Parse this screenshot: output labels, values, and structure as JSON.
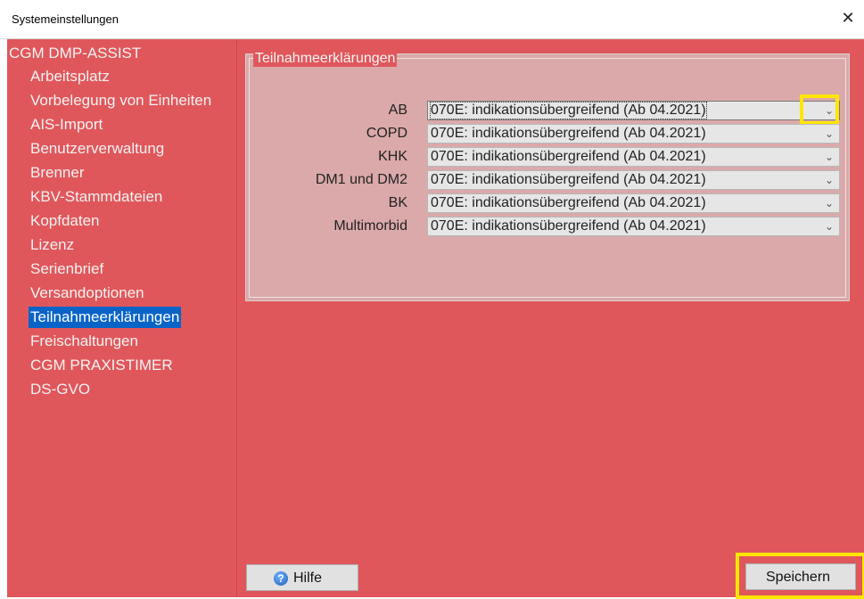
{
  "window": {
    "title": "Systemeinstellungen",
    "close_glyph": "✕"
  },
  "sidebar": {
    "root": "CGM DMP-ASSIST",
    "items": [
      {
        "label": "Arbeitsplatz"
      },
      {
        "label": "Vorbelegung von Einheiten"
      },
      {
        "label": "AIS-Import"
      },
      {
        "label": "Benutzerverwaltung"
      },
      {
        "label": "Brenner"
      },
      {
        "label": "KBV-Stammdateien"
      },
      {
        "label": "Kopfdaten"
      },
      {
        "label": "Lizenz"
      },
      {
        "label": "Serienbrief"
      },
      {
        "label": "Versandoptionen"
      },
      {
        "label": "Teilnahmeerklärungen",
        "selected": true
      },
      {
        "label": "Freischaltungen"
      },
      {
        "label": "CGM PRAXISTIMER"
      },
      {
        "label": "DS-GVO"
      }
    ]
  },
  "panel": {
    "title": "Teilnahmeerklärungen",
    "rows": [
      {
        "label": "AB",
        "value": "070E: indikationsübergreifend (Ab 04.2021)"
      },
      {
        "label": "COPD",
        "value": "070E: indikationsübergreifend (Ab 04.2021)"
      },
      {
        "label": "KHK",
        "value": "070E: indikationsübergreifend (Ab 04.2021)"
      },
      {
        "label": "DM1 und DM2",
        "value": "070E: indikationsübergreifend (Ab 04.2021)"
      },
      {
        "label": "BK",
        "value": "070E: indikationsübergreifend (Ab 04.2021)"
      },
      {
        "label": "Multimorbid",
        "value": "070E: indikationsübergreifend (Ab 04.2021)"
      }
    ]
  },
  "buttons": {
    "help": "Hilfe",
    "save": "Speichern"
  },
  "icons": {
    "help": "help-circle-icon",
    "dropdown": "chevron-down-icon",
    "close": "close-icon"
  },
  "colors": {
    "panel_bg": "#e0575b",
    "selection": "#0a64c8",
    "highlight": "#ffe600"
  }
}
